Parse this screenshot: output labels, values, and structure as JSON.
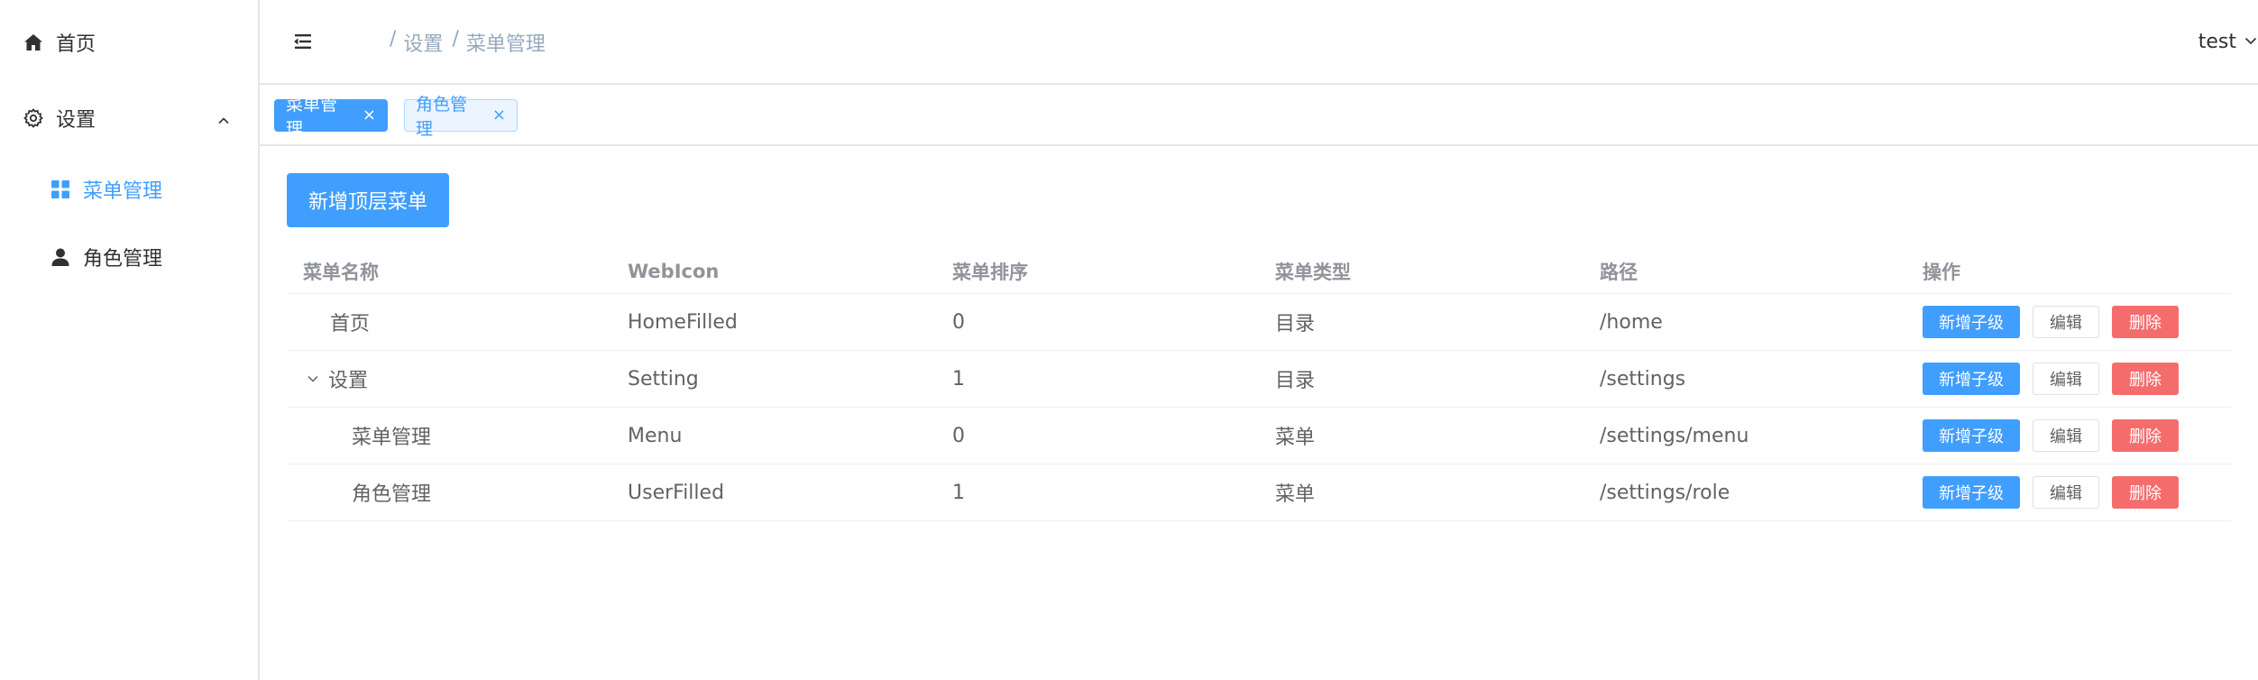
{
  "sidebar": {
    "items": [
      {
        "label": "首页",
        "icon": "home-icon"
      },
      {
        "label": "设置",
        "icon": "gear-icon"
      },
      {
        "label": "菜单管理",
        "icon": "grid-icon"
      },
      {
        "label": "角色管理",
        "icon": "user-icon"
      }
    ]
  },
  "header": {
    "breadcrumb": [
      "设置",
      "菜单管理"
    ],
    "breadcrumb_sep": "/",
    "user": "test"
  },
  "tags": [
    {
      "label": "菜单管理",
      "close": "×"
    },
    {
      "label": "角色管理",
      "close": "×"
    }
  ],
  "main": {
    "add_top_label": "新增顶层菜单"
  },
  "table": {
    "columns": [
      "菜单名称",
      "WebIcon",
      "菜单排序",
      "菜单类型",
      "路径",
      "操作"
    ],
    "rows": [
      {
        "name": "首页",
        "icon": "HomeFilled",
        "order": "0",
        "type": "目录",
        "path": "/home"
      },
      {
        "name": "设置",
        "icon": "Setting",
        "order": "1",
        "type": "目录",
        "path": "/settings"
      },
      {
        "name": "菜单管理",
        "icon": "Menu",
        "order": "0",
        "type": "菜单",
        "path": "/settings/menu"
      },
      {
        "name": "角色管理",
        "icon": "UserFilled",
        "order": "1",
        "type": "菜单",
        "path": "/settings/role"
      }
    ],
    "ops": {
      "add": "新增子级",
      "edit": "编辑",
      "delete": "删除"
    }
  },
  "colors": {
    "primary": "#409eff",
    "danger": "#f56c6c",
    "border": "#e6e6e6"
  }
}
